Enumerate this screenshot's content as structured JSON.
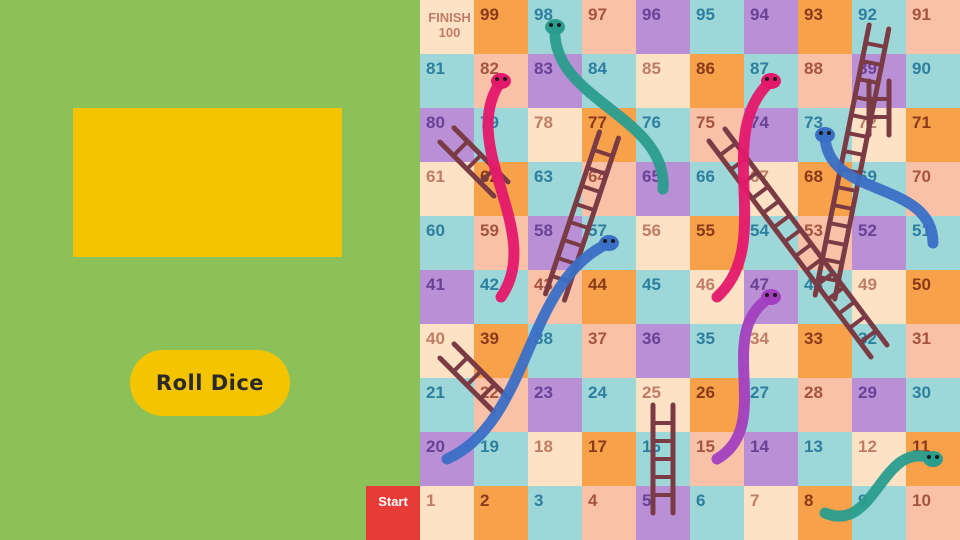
{
  "controls": {
    "roll_label": "Roll Dice",
    "start_label": "Start"
  },
  "board": {
    "finish_label": "FINISH",
    "rows": 10,
    "cols": 10,
    "palette": {
      "lavender": "#b98fd6",
      "orange": "#f7a24b",
      "teal": "#9ed7d8",
      "cream": "#fde2c5",
      "peach": "#f9c2a8"
    },
    "text_colors": {
      "lavender": "#6a4195",
      "orange": "#8a3a1a",
      "teal": "#2d7fa0",
      "cream": "#c07d66",
      "peach": "#a4543f"
    },
    "cells": [
      {
        "n": 1,
        "c": "cream"
      },
      {
        "n": 2,
        "c": "orange"
      },
      {
        "n": 3,
        "c": "teal"
      },
      {
        "n": 4,
        "c": "peach"
      },
      {
        "n": 5,
        "c": "lavender"
      },
      {
        "n": 6,
        "c": "teal"
      },
      {
        "n": 7,
        "c": "cream"
      },
      {
        "n": 8,
        "c": "orange"
      },
      {
        "n": 9,
        "c": "teal"
      },
      {
        "n": 10,
        "c": "peach"
      },
      {
        "n": 11,
        "c": "orange"
      },
      {
        "n": 12,
        "c": "cream"
      },
      {
        "n": 13,
        "c": "teal"
      },
      {
        "n": 14,
        "c": "lavender"
      },
      {
        "n": 15,
        "c": "peach"
      },
      {
        "n": 16,
        "c": "teal"
      },
      {
        "n": 17,
        "c": "orange"
      },
      {
        "n": 18,
        "c": "cream"
      },
      {
        "n": 19,
        "c": "teal"
      },
      {
        "n": 20,
        "c": "lavender"
      },
      {
        "n": 21,
        "c": "teal"
      },
      {
        "n": 22,
        "c": "peach"
      },
      {
        "n": 23,
        "c": "lavender"
      },
      {
        "n": 24,
        "c": "teal"
      },
      {
        "n": 25,
        "c": "cream"
      },
      {
        "n": 26,
        "c": "orange"
      },
      {
        "n": 27,
        "c": "teal"
      },
      {
        "n": 28,
        "c": "peach"
      },
      {
        "n": 29,
        "c": "lavender"
      },
      {
        "n": 30,
        "c": "teal"
      },
      {
        "n": 31,
        "c": "peach"
      },
      {
        "n": 32,
        "c": "teal"
      },
      {
        "n": 33,
        "c": "orange"
      },
      {
        "n": 34,
        "c": "cream"
      },
      {
        "n": 35,
        "c": "teal"
      },
      {
        "n": 36,
        "c": "lavender"
      },
      {
        "n": 37,
        "c": "peach"
      },
      {
        "n": 38,
        "c": "teal"
      },
      {
        "n": 39,
        "c": "orange"
      },
      {
        "n": 40,
        "c": "cream"
      },
      {
        "n": 41,
        "c": "lavender"
      },
      {
        "n": 42,
        "c": "teal"
      },
      {
        "n": 43,
        "c": "peach"
      },
      {
        "n": 44,
        "c": "orange"
      },
      {
        "n": 45,
        "c": "teal"
      },
      {
        "n": 46,
        "c": "cream"
      },
      {
        "n": 47,
        "c": "lavender"
      },
      {
        "n": 48,
        "c": "teal"
      },
      {
        "n": 49,
        "c": "cream"
      },
      {
        "n": 50,
        "c": "orange"
      },
      {
        "n": 51,
        "c": "teal"
      },
      {
        "n": 52,
        "c": "lavender"
      },
      {
        "n": 53,
        "c": "peach"
      },
      {
        "n": 54,
        "c": "teal"
      },
      {
        "n": 55,
        "c": "orange"
      },
      {
        "n": 56,
        "c": "cream"
      },
      {
        "n": 57,
        "c": "teal"
      },
      {
        "n": 58,
        "c": "lavender"
      },
      {
        "n": 59,
        "c": "peach"
      },
      {
        "n": 60,
        "c": "teal"
      },
      {
        "n": 61,
        "c": "cream"
      },
      {
        "n": 62,
        "c": "orange"
      },
      {
        "n": 63,
        "c": "teal"
      },
      {
        "n": 64,
        "c": "peach"
      },
      {
        "n": 65,
        "c": "lavender"
      },
      {
        "n": 66,
        "c": "teal"
      },
      {
        "n": 67,
        "c": "cream"
      },
      {
        "n": 68,
        "c": "orange"
      },
      {
        "n": 69,
        "c": "teal"
      },
      {
        "n": 70,
        "c": "peach"
      },
      {
        "n": 71,
        "c": "orange"
      },
      {
        "n": 72,
        "c": "cream"
      },
      {
        "n": 73,
        "c": "teal"
      },
      {
        "n": 74,
        "c": "lavender"
      },
      {
        "n": 75,
        "c": "peach"
      },
      {
        "n": 76,
        "c": "teal"
      },
      {
        "n": 77,
        "c": "orange"
      },
      {
        "n": 78,
        "c": "cream"
      },
      {
        "n": 79,
        "c": "teal"
      },
      {
        "n": 80,
        "c": "lavender"
      },
      {
        "n": 81,
        "c": "teal"
      },
      {
        "n": 82,
        "c": "peach"
      },
      {
        "n": 83,
        "c": "lavender"
      },
      {
        "n": 84,
        "c": "teal"
      },
      {
        "n": 85,
        "c": "cream"
      },
      {
        "n": 86,
        "c": "orange"
      },
      {
        "n": 87,
        "c": "teal"
      },
      {
        "n": 88,
        "c": "peach"
      },
      {
        "n": 89,
        "c": "lavender"
      },
      {
        "n": 90,
        "c": "teal"
      },
      {
        "n": 91,
        "c": "peach"
      },
      {
        "n": 92,
        "c": "teal"
      },
      {
        "n": 93,
        "c": "orange"
      },
      {
        "n": 94,
        "c": "lavender"
      },
      {
        "n": 95,
        "c": "teal"
      },
      {
        "n": 96,
        "c": "lavender"
      },
      {
        "n": 97,
        "c": "peach"
      },
      {
        "n": 98,
        "c": "teal"
      },
      {
        "n": 99,
        "c": "orange"
      },
      {
        "n": 100,
        "c": "cream"
      }
    ],
    "ladders": [
      {
        "from": 22,
        "to": 40
      },
      {
        "from": 43,
        "to": 77
      },
      {
        "from": 5,
        "to": 25
      },
      {
        "from": 48,
        "to": 92
      },
      {
        "from": 32,
        "to": 75
      },
      {
        "from": 72,
        "to": 89
      },
      {
        "from": 62,
        "to": 80
      }
    ],
    "snakes": [
      {
        "head": 87,
        "tail": 46,
        "color": "#e4186b"
      },
      {
        "head": 98,
        "tail": 65,
        "color": "#2a9d8f"
      },
      {
        "head": 82,
        "tail": 42,
        "color": "#e4186b"
      },
      {
        "head": 73,
        "tail": 51,
        "color": "#3a6fc6"
      },
      {
        "head": 57,
        "tail": 20,
        "color": "#3a6fc6"
      },
      {
        "head": 47,
        "tail": 15,
        "color": "#a23fbf"
      },
      {
        "head": 11,
        "tail": 8,
        "color": "#2a9d8f"
      }
    ]
  }
}
